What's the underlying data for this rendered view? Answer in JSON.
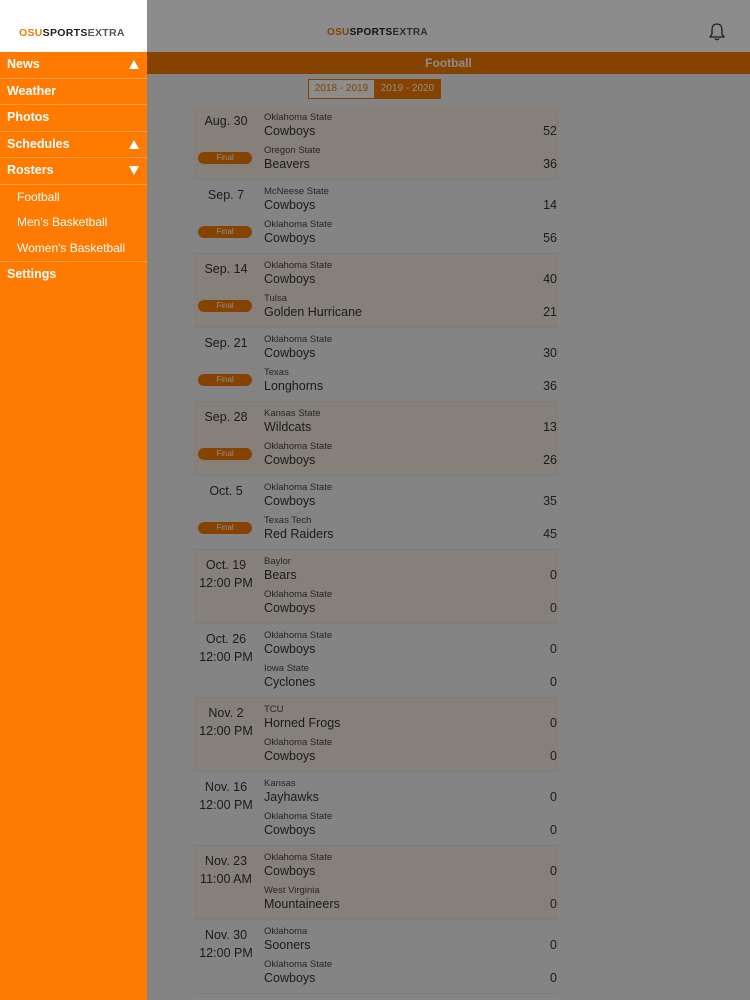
{
  "header": {
    "logo": {
      "part1": "OSU",
      "part2": "SPORTS",
      "part3": "EXTRA"
    },
    "title": "Football",
    "icons": {
      "bell": "bell-icon"
    }
  },
  "seasons": [
    {
      "label": "2018 - 2019",
      "selected": false
    },
    {
      "label": "2019 - 2020",
      "selected": true
    }
  ],
  "sidebar": {
    "logo": {
      "part1": "OSU",
      "part2": "SPORTS",
      "part3": "EXTRA"
    },
    "items": [
      {
        "label": "News",
        "expand": "up"
      },
      {
        "label": "Weather"
      },
      {
        "label": "Photos"
      },
      {
        "label": "Schedules",
        "expand": "up"
      },
      {
        "label": "Rosters",
        "expand": "down"
      },
      {
        "label": "Football",
        "sub": true
      },
      {
        "label": "Men's Basketball",
        "sub": true
      },
      {
        "label": "Women's Basketball",
        "sub": true
      },
      {
        "label": "Settings"
      }
    ]
  },
  "games": [
    {
      "date": "Aug. 30",
      "time": "",
      "status": "Final",
      "team1": {
        "school": "Oklahoma State",
        "mascot": "Cowboys",
        "score": "52"
      },
      "team2": {
        "school": "Oregon State",
        "mascot": "Beavers",
        "score": "36"
      }
    },
    {
      "date": "Sep. 7",
      "time": "",
      "status": "Final",
      "team1": {
        "school": "McNeese State",
        "mascot": "Cowboys",
        "score": "14"
      },
      "team2": {
        "school": "Oklahoma State",
        "mascot": "Cowboys",
        "score": "56"
      }
    },
    {
      "date": "Sep. 14",
      "time": "",
      "status": "Final",
      "team1": {
        "school": "Oklahoma State",
        "mascot": "Cowboys",
        "score": "40"
      },
      "team2": {
        "school": "Tulsa",
        "mascot": "Golden Hurricane",
        "score": "21"
      }
    },
    {
      "date": "Sep. 21",
      "time": "",
      "status": "Final",
      "team1": {
        "school": "Oklahoma State",
        "mascot": "Cowboys",
        "score": "30"
      },
      "team2": {
        "school": "Texas",
        "mascot": "Longhorns",
        "score": "36"
      }
    },
    {
      "date": "Sep. 28",
      "time": "",
      "status": "Final",
      "team1": {
        "school": "Kansas State",
        "mascot": "Wildcats",
        "score": "13"
      },
      "team2": {
        "school": "Oklahoma State",
        "mascot": "Cowboys",
        "score": "26"
      }
    },
    {
      "date": "Oct. 5",
      "time": "",
      "status": "Final",
      "team1": {
        "school": "Oklahoma State",
        "mascot": "Cowboys",
        "score": "35"
      },
      "team2": {
        "school": "Texas Tech",
        "mascot": "Red Raiders",
        "score": "45"
      }
    },
    {
      "date": "Oct. 19",
      "time": "12:00 PM",
      "status": "",
      "team1": {
        "school": "Baylor",
        "mascot": "Bears",
        "score": "0"
      },
      "team2": {
        "school": "Oklahoma State",
        "mascot": "Cowboys",
        "score": "0"
      }
    },
    {
      "date": "Oct. 26",
      "time": "12:00 PM",
      "status": "",
      "team1": {
        "school": "Oklahoma State",
        "mascot": "Cowboys",
        "score": "0"
      },
      "team2": {
        "school": "Iowa State",
        "mascot": "Cyclones",
        "score": "0"
      }
    },
    {
      "date": "Nov. 2",
      "time": "12:00 PM",
      "status": "",
      "team1": {
        "school": "TCU",
        "mascot": "Horned Frogs",
        "score": "0"
      },
      "team2": {
        "school": "Oklahoma State",
        "mascot": "Cowboys",
        "score": "0"
      }
    },
    {
      "date": "Nov. 16",
      "time": "12:00 PM",
      "status": "",
      "team1": {
        "school": "Kansas",
        "mascot": "Jayhawks",
        "score": "0"
      },
      "team2": {
        "school": "Oklahoma State",
        "mascot": "Cowboys",
        "score": "0"
      }
    },
    {
      "date": "Nov. 23",
      "time": "11:00 AM",
      "status": "",
      "team1": {
        "school": "Oklahoma State",
        "mascot": "Cowboys",
        "score": "0"
      },
      "team2": {
        "school": "West Virginia",
        "mascot": "Mountaineers",
        "score": "0"
      }
    },
    {
      "date": "Nov. 30",
      "time": "12:00 PM",
      "status": "",
      "team1": {
        "school": "Oklahoma",
        "mascot": "Sooners",
        "score": "0"
      },
      "team2": {
        "school": "Oklahoma State",
        "mascot": "Cowboys",
        "score": "0"
      }
    }
  ],
  "colors": {
    "accent": "#f57a00",
    "sidebar": "#ff7a00"
  }
}
